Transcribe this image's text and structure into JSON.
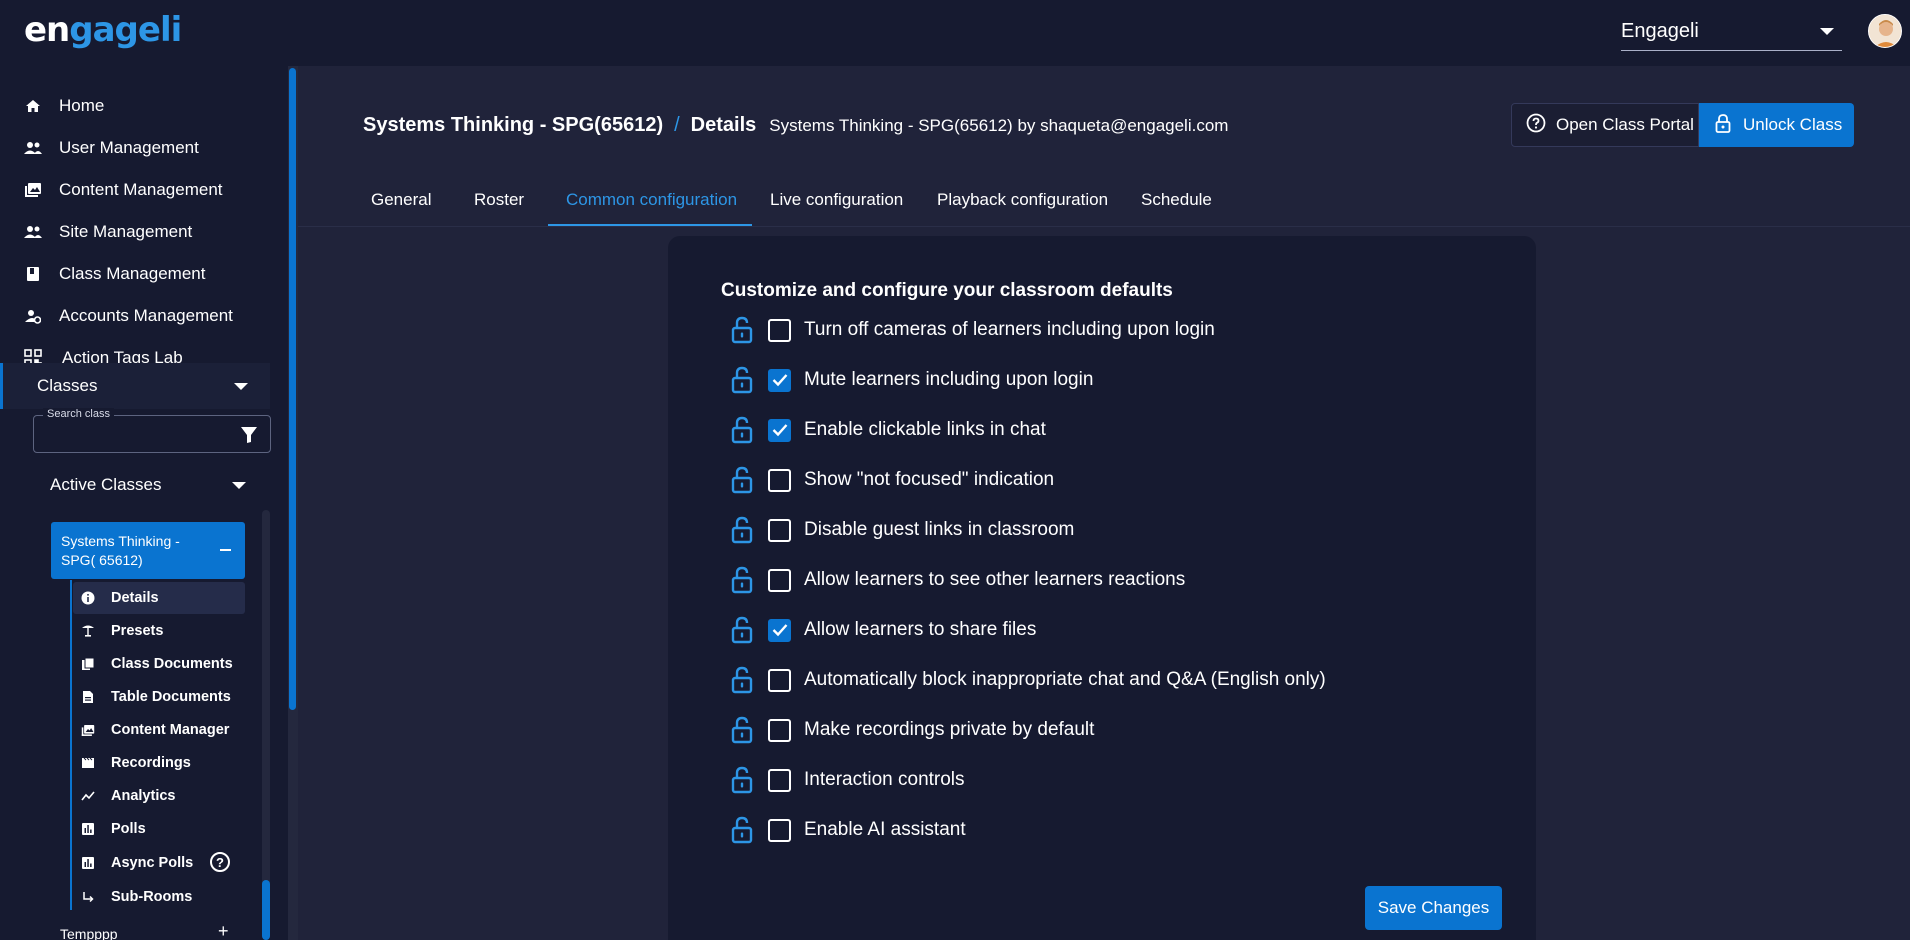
{
  "header": {
    "logo_text_a": "en",
    "logo_text_b": "gageli",
    "org_select_value": "Engageli",
    "accent_color": "#0a74d0"
  },
  "sidebar": {
    "nav": [
      {
        "label": "Home",
        "icon": "home-icon"
      },
      {
        "label": "User Management",
        "icon": "users-icon"
      },
      {
        "label": "Content Management",
        "icon": "images-icon"
      },
      {
        "label": "Site Management",
        "icon": "people-icon"
      },
      {
        "label": "Class Management",
        "icon": "book-icon"
      },
      {
        "label": "Accounts Management",
        "icon": "account-settings-icon"
      },
      {
        "label": "Action Tags Lab",
        "icon": "qr-code-icon"
      }
    ],
    "classes_label": "Classes",
    "search_legend": "Search class",
    "search_value": "",
    "active_classes_label": "Active Classes",
    "selected_class": "Systems Thinking - SPG( 65612)",
    "sub_items": [
      {
        "label": "Details",
        "icon": "info-icon"
      },
      {
        "label": "Presets",
        "icon": "umbrella-icon"
      },
      {
        "label": "Class Documents",
        "icon": "documents-icon"
      },
      {
        "label": "Table Documents",
        "icon": "document-icon"
      },
      {
        "label": "Content Manager",
        "icon": "images-icon"
      },
      {
        "label": "Recordings",
        "icon": "clapperboard-icon"
      },
      {
        "label": "Analytics",
        "icon": "trend-icon"
      },
      {
        "label": "Polls",
        "icon": "poll-icon"
      },
      {
        "label": "Async Polls",
        "icon": "poll-icon"
      },
      {
        "label": "Sub-Rooms",
        "icon": "subdirectory-arrow-icon"
      }
    ],
    "help_glyph": "?",
    "next_class_label": "Tempppp",
    "next_class_plus": "+"
  },
  "main": {
    "breadcrumb": {
      "class_name": "Systems Thinking - SPG(65612)",
      "separator": "/",
      "page": "Details",
      "subtitle": "Systems Thinking - SPG(65612) by shaqueta@engageli.com"
    },
    "open_portal_label": "Open Class Portal",
    "unlock_label": "Unlock Class",
    "tabs": [
      {
        "label": "General",
        "active": false
      },
      {
        "label": "Roster",
        "active": false
      },
      {
        "label": "Common configuration",
        "active": true
      },
      {
        "label": "Live configuration",
        "active": false
      },
      {
        "label": "Playback configuration",
        "active": false
      },
      {
        "label": "Schedule",
        "active": false
      }
    ],
    "card_title": "Customize and configure your classroom defaults",
    "options": [
      {
        "label": "Turn off cameras of learners including upon login",
        "checked": false
      },
      {
        "label": "Mute learners including upon login",
        "checked": true
      },
      {
        "label": "Enable clickable links in chat",
        "checked": true
      },
      {
        "label": "Show \"not focused\" indication",
        "checked": false
      },
      {
        "label": "Disable guest links in classroom",
        "checked": false
      },
      {
        "label": "Allow learners to see other learners reactions",
        "checked": false
      },
      {
        "label": "Allow learners to share files",
        "checked": true
      },
      {
        "label": "Automatically block inappropriate chat and Q&A (English only)",
        "checked": false
      },
      {
        "label": "Make recordings private by default",
        "checked": false
      },
      {
        "label": "Interaction controls",
        "checked": false
      },
      {
        "label": "Enable AI assistant",
        "checked": false
      }
    ],
    "save_label": "Save Changes"
  }
}
